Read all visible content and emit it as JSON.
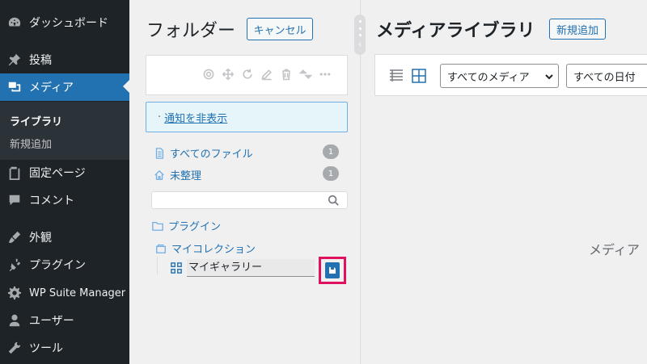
{
  "sidebar": {
    "items": [
      {
        "label": "ダッシュボード",
        "icon": "dashboard-icon"
      },
      {
        "label": "投稿",
        "icon": "pin-icon"
      },
      {
        "label": "メディア",
        "icon": "media-icon",
        "active": true
      },
      {
        "label": "固定ページ",
        "icon": "page-icon"
      },
      {
        "label": "コメント",
        "icon": "comment-icon"
      },
      {
        "label": "外観",
        "icon": "brush-icon"
      },
      {
        "label": "プラグイン",
        "icon": "plugin-icon"
      },
      {
        "label": "WP Suite Manager",
        "icon": "gear-icon"
      },
      {
        "label": "ユーザー",
        "icon": "user-icon"
      },
      {
        "label": "ツール",
        "icon": "wrench-icon"
      }
    ],
    "submenu": [
      {
        "label": "ライブラリ",
        "current": true
      },
      {
        "label": "新規追加",
        "current": false
      }
    ]
  },
  "folders": {
    "title": "フォルダー",
    "cancel_label": "キャンセル",
    "notice_prefix": "·",
    "notice_link": "通知を非表示",
    "all_files": {
      "label": "すべてのファイル",
      "count": "1"
    },
    "unsorted": {
      "label": "未整理",
      "count": "1"
    },
    "search_placeholder": "",
    "tree": [
      {
        "label": "プラグイン",
        "icon": "folder-icon"
      },
      {
        "label": "マイコレクション",
        "icon": "collection-icon"
      }
    ],
    "editing": {
      "value": "マイギャラリー",
      "icon": "gallery-icon",
      "save_icon": "save-icon"
    }
  },
  "main": {
    "title": "メディアライブラリ",
    "add_new_label": "新規追加",
    "filter_media": "すべてのメディア",
    "filter_date": "すべての日付",
    "empty_text": "メディア"
  },
  "colors": {
    "sidebar_bg": "#1d2327",
    "accent": "#2271b1",
    "highlight": "#e0115f"
  }
}
